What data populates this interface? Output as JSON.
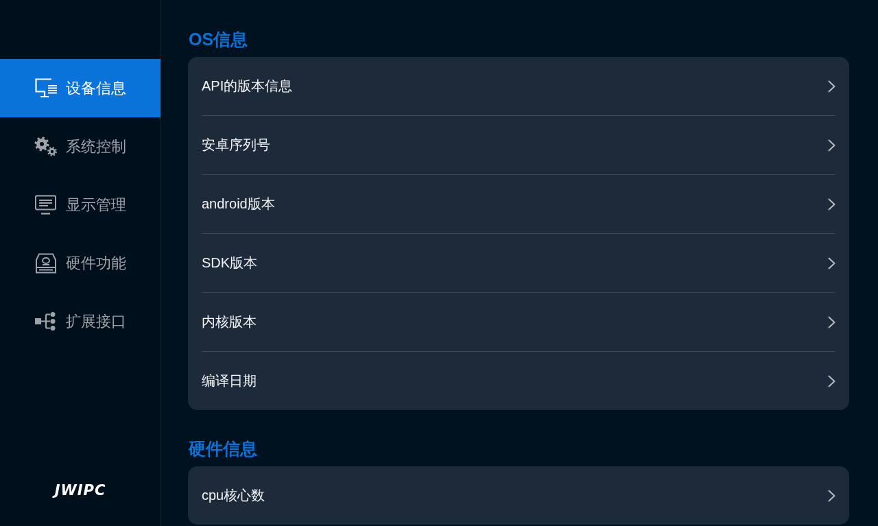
{
  "sidebar": {
    "items": [
      {
        "label": "设备信息",
        "selected": true
      },
      {
        "label": "系统控制",
        "selected": false
      },
      {
        "label": "显示管理",
        "selected": false
      },
      {
        "label": "硬件功能",
        "selected": false
      },
      {
        "label": "扩展接口",
        "selected": false
      }
    ],
    "logo": "JWIPC"
  },
  "sections": [
    {
      "title": "OS信息",
      "rows": [
        {
          "label": "API的版本信息"
        },
        {
          "label": "安卓序列号"
        },
        {
          "label": "android版本"
        },
        {
          "label": "SDK版本"
        },
        {
          "label": "内核版本"
        },
        {
          "label": "编译日期"
        }
      ]
    },
    {
      "title": "硬件信息",
      "rows": [
        {
          "label": "cpu核心数"
        }
      ]
    }
  ]
}
